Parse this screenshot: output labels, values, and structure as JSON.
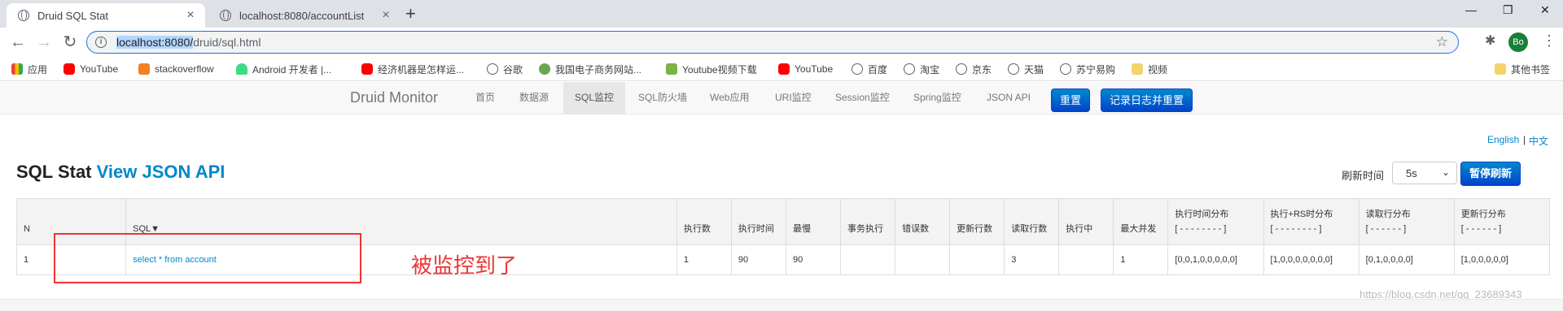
{
  "browser": {
    "tabs": [
      {
        "title": "Druid SQL Stat",
        "active": true
      },
      {
        "title": "localhost:8080/accountList",
        "active": false
      }
    ],
    "address": {
      "host": "localhost:8080/",
      "path": "druid/sql.html"
    },
    "profile_initials": "Bo",
    "bookmarks": [
      {
        "label": "应用",
        "icon": "apps-icon"
      },
      {
        "label": "YouTube",
        "icon": "youtube-icon"
      },
      {
        "label": "stackoverflow",
        "icon": "stackoverflow-icon"
      },
      {
        "label": "Android 开发者 |...",
        "icon": "android-icon"
      },
      {
        "label": "经济机器是怎样运...",
        "icon": "youtube-icon"
      },
      {
        "label": "谷歌",
        "icon": "globe-icon"
      },
      {
        "label": "我国电子商务网站...",
        "icon": "site-icon"
      },
      {
        "label": "Youtube视频下载",
        "icon": "download-icon"
      },
      {
        "label": "YouTube",
        "icon": "youtube-icon"
      },
      {
        "label": "百度",
        "icon": "globe-icon"
      },
      {
        "label": "淘宝",
        "icon": "globe-icon"
      },
      {
        "label": "京东",
        "icon": "globe-icon"
      },
      {
        "label": "天猫",
        "icon": "globe-icon"
      },
      {
        "label": "苏宁易购",
        "icon": "globe-icon"
      },
      {
        "label": "视频",
        "icon": "folder-icon"
      }
    ],
    "other_bookmarks": "其他书签"
  },
  "druid": {
    "brand": "Druid Monitor",
    "nav": [
      "首页",
      "数据源",
      "SQL监控",
      "SQL防火墙",
      "Web应用",
      "URI监控",
      "Session监控",
      "Spring监控",
      "JSON API"
    ],
    "active_nav": "SQL监控",
    "reset_label": "重置",
    "log_reset_label": "记录日志并重置"
  },
  "page": {
    "lang_en": "English",
    "lang_sep": "|",
    "lang_zh": "中文",
    "title": "SQL Stat",
    "title_link": "View JSON API",
    "refresh_label": "刷新时间",
    "refresh_value": "5s",
    "pause_label": "暂停刷新"
  },
  "table": {
    "headers": [
      {
        "l1": "N",
        "l2": ""
      },
      {
        "l1": "SQL▼",
        "l2": ""
      },
      {
        "l1": "执行数",
        "l2": ""
      },
      {
        "l1": "执行时间",
        "l2": ""
      },
      {
        "l1": "最慢",
        "l2": ""
      },
      {
        "l1": "事务执行",
        "l2": ""
      },
      {
        "l1": "错误数",
        "l2": ""
      },
      {
        "l1": "更新行数",
        "l2": ""
      },
      {
        "l1": "读取行数",
        "l2": ""
      },
      {
        "l1": "执行中",
        "l2": ""
      },
      {
        "l1": "最大并发",
        "l2": ""
      },
      {
        "l1": "执行时间分布",
        "l2": "[ - - - - - - - - ]"
      },
      {
        "l1": "执行+RS时分布",
        "l2": "[ - - - - - - - - ]"
      },
      {
        "l1": "读取行分布",
        "l2": "[ - - - - - - ]"
      },
      {
        "l1": "更新行分布",
        "l2": "[ - - - - - - ]"
      }
    ],
    "rows": [
      [
        "1",
        "select * from account",
        "1",
        "90",
        "90",
        "",
        "",
        "",
        "3",
        "",
        "1",
        "[0,0,1,0,0,0,0,0]",
        "[1,0,0,0,0,0,0,0]",
        "[0,1,0,0,0,0]",
        "[1,0,0,0,0,0]"
      ]
    ]
  },
  "annotation": {
    "text": "被监控到了"
  },
  "watermark": "https://blog.csdn.net/qq_23689343"
}
